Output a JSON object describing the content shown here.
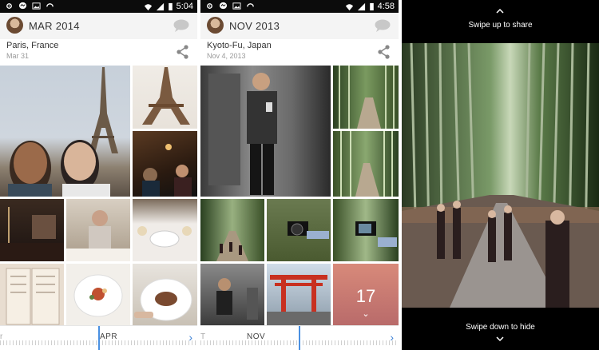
{
  "panel1": {
    "status_time": "5:04",
    "header_title": "MAR 2014",
    "place": "Paris, France",
    "date": "Mar 31",
    "timeline_label": "APR",
    "timeline_left": "r"
  },
  "panel2": {
    "status_time": "4:58",
    "header_title": "NOV 2013",
    "place": "Kyoto-Fu, Japan",
    "date": "Nov 4, 2013",
    "timeline_label": "NOV",
    "timeline_left": "T",
    "overflow_count": "17"
  },
  "panel3": {
    "swipe_up": "Swipe up to share",
    "swipe_down": "Swipe down to hide"
  },
  "colors": {
    "accent": "#4a90e2",
    "header_bg": "#f4f4f4",
    "status_bg": "#0c0c0c"
  },
  "icons": [
    "settings-icon",
    "messenger-icon",
    "image-icon",
    "sync-icon",
    "wifi-icon",
    "signal-icon",
    "battery-icon",
    "chat-bubble-icon",
    "share-icon",
    "chevron-right-icon",
    "chevron-up-icon",
    "chevron-down-icon"
  ]
}
